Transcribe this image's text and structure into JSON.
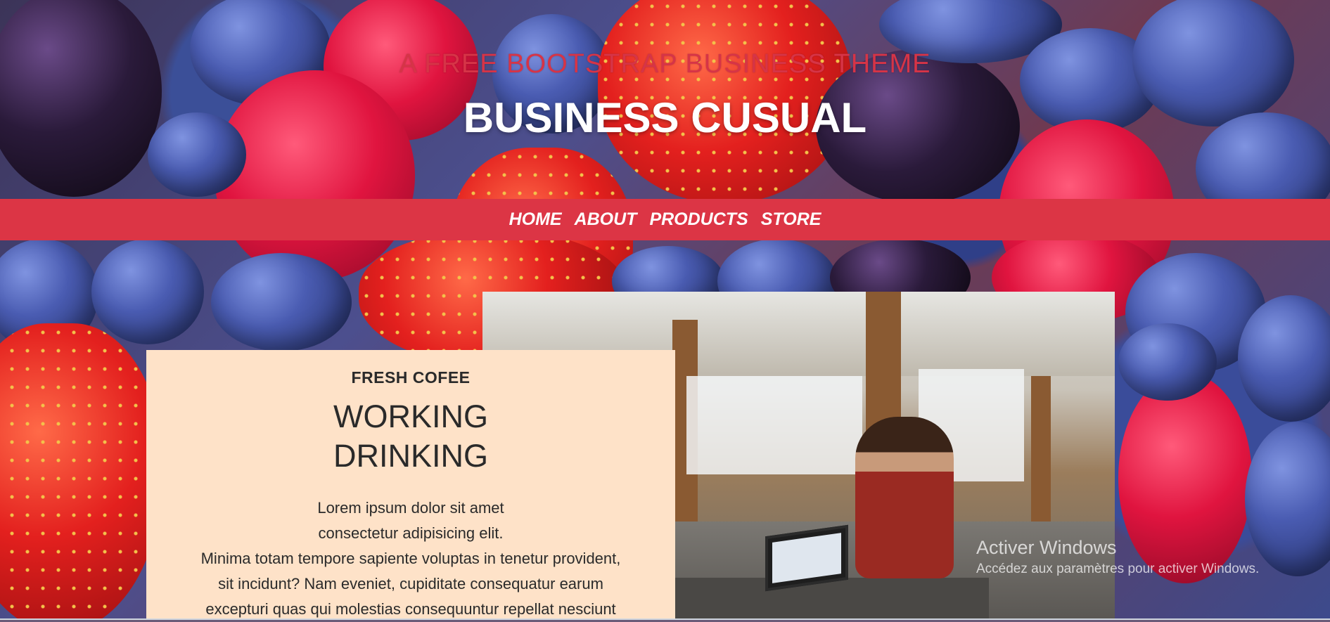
{
  "header": {
    "subtitle": "A Free Bootstrap Business Theme",
    "title": "Business Cusual"
  },
  "nav": {
    "items": [
      {
        "label": "HOME"
      },
      {
        "label": "ABOUT"
      },
      {
        "label": "PRODUCTS"
      },
      {
        "label": "STORE"
      }
    ]
  },
  "card": {
    "kicker": "FRESH COFEE",
    "heading_line1": "WORKING",
    "heading_line2": "DRINKING",
    "body_line1": "Lorem ipsum dolor sit amet",
    "body_line2": "consectetur adipisicing elit.",
    "body_line3": "Minima totam tempore sapiente voluptas in tenetur provident,",
    "body_line4": "sit incidunt? Nam eveniet, cupiditate consequatur earum",
    "body_line5": "excepturi quas qui molestias consequuntur repellat nesciunt"
  },
  "watermark": {
    "title": "Activer Windows",
    "subtitle": "Accédez aux paramètres pour activer Windows."
  },
  "colors": {
    "accent": "#dc3545",
    "card_bg": "#fee2c8"
  }
}
